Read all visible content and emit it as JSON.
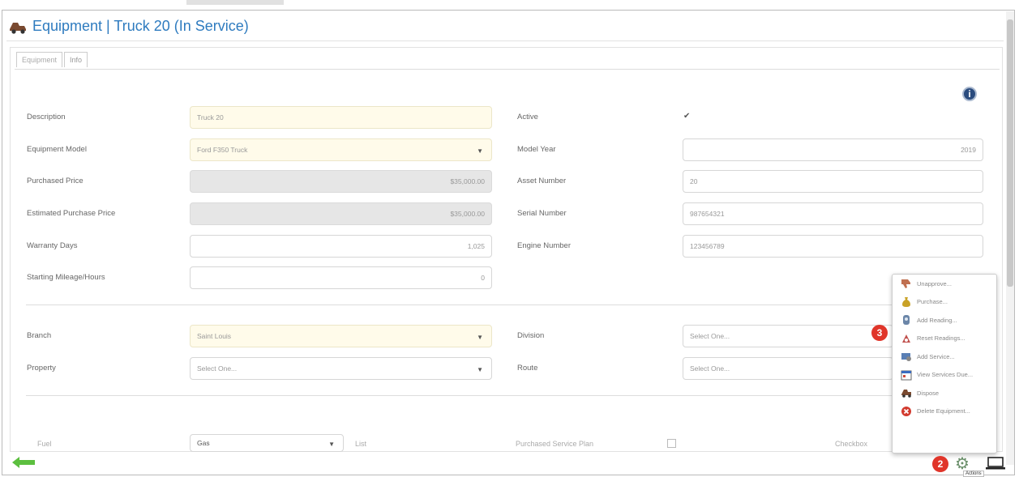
{
  "window": {
    "title": "Equipment | Truck 20 (In Service)"
  },
  "tabs": [
    {
      "label": "Equipment"
    },
    {
      "label": "Info"
    }
  ],
  "form": {
    "description": {
      "label": "Description",
      "value": "Truck 20"
    },
    "equipment_model": {
      "label": "Equipment Model",
      "value": "Ford F350 Truck"
    },
    "purchased_price": {
      "label": "Purchased Price",
      "value": "$35,000.00"
    },
    "estimated_purchase_price": {
      "label": "Estimated Purchase Price",
      "value": "$35,000.00"
    },
    "warranty_days": {
      "label": "Warranty Days",
      "value": "1,025"
    },
    "starting_mileage": {
      "label": "Starting Mileage/Hours",
      "value": "0"
    },
    "active": {
      "label": "Active",
      "checked": true,
      "mark": "✔"
    },
    "model_year": {
      "label": "Model Year",
      "value": "2019"
    },
    "asset_number": {
      "label": "Asset Number",
      "value": "20"
    },
    "serial_number": {
      "label": "Serial Number",
      "value": "987654321"
    },
    "engine_number": {
      "label": "Engine Number",
      "value": "123456789"
    },
    "branch": {
      "label": "Branch",
      "value": "Saint Louis"
    },
    "property": {
      "label": "Property",
      "placeholder": "Select One..."
    },
    "division": {
      "label": "Division",
      "placeholder": "Select One..."
    },
    "route": {
      "label": "Route",
      "placeholder": "Select One..."
    },
    "fuel": {
      "label": "Fuel",
      "value": "Gas"
    },
    "list": {
      "label": "List"
    },
    "purchased_service_plan": {
      "label": "Purchased Service Plan"
    },
    "checkbox_label": {
      "label": "Checkbox"
    }
  },
  "actions_menu": {
    "items": [
      {
        "label": "Unapprove...",
        "icon": "thumbs-down-icon"
      },
      {
        "label": "Purchase...",
        "icon": "money-bag-icon"
      },
      {
        "label": "Add Reading...",
        "icon": "gauge-icon"
      },
      {
        "label": "Reset Readings...",
        "icon": "reset-icon"
      },
      {
        "label": "Add Service...",
        "icon": "wrench-service-icon"
      },
      {
        "label": "View Services Due...",
        "icon": "calendar-icon"
      },
      {
        "label": "Dispose",
        "icon": "truck-icon"
      },
      {
        "label": "Delete Equipment...",
        "icon": "delete-icon"
      }
    ]
  },
  "annotations": {
    "badge_2": "2",
    "badge_3": "3"
  },
  "footer": {
    "actions_tooltip": "Actions"
  },
  "colors": {
    "title": "#2e7bbf",
    "badge": "#e0352a",
    "required_field_bg": "#fffbea",
    "disabled_field_bg": "#e6e6e6"
  }
}
